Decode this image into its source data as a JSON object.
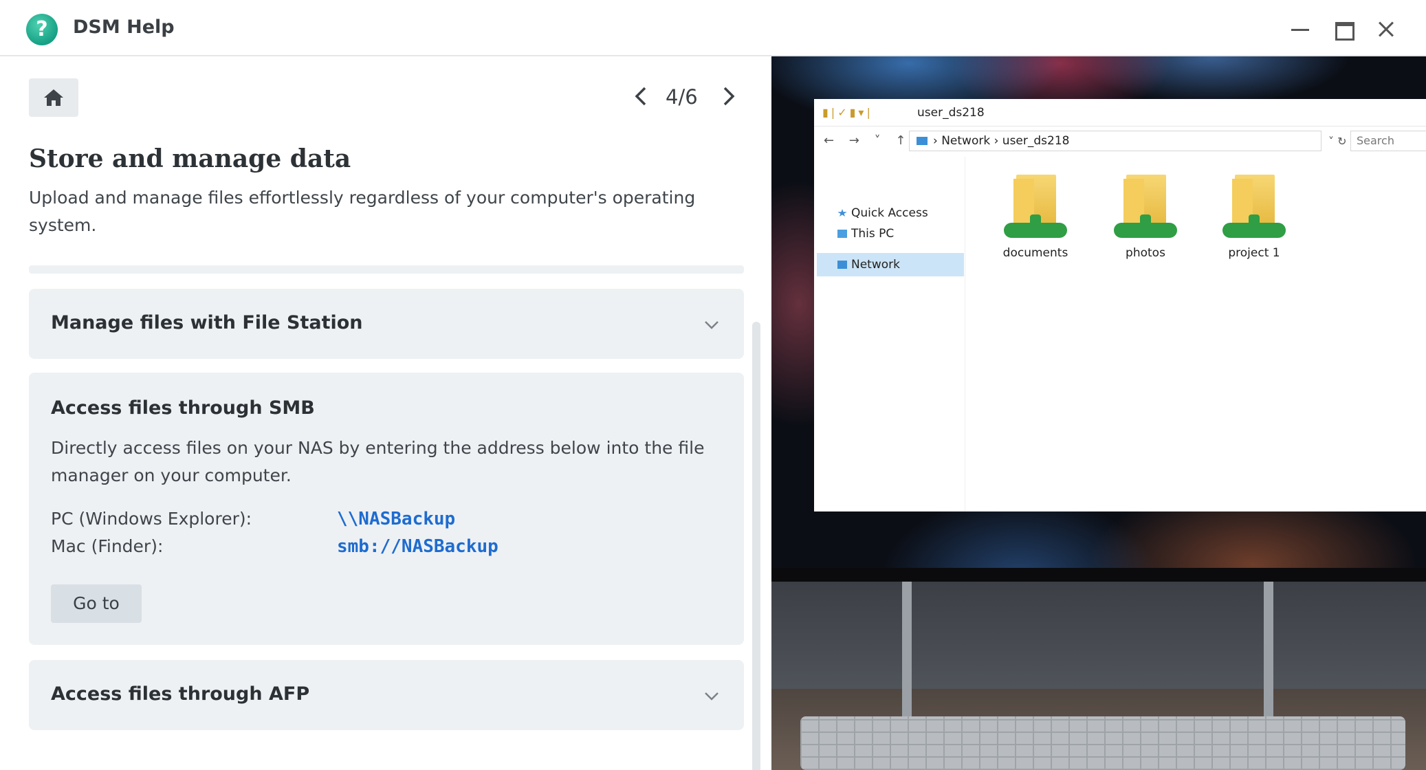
{
  "window": {
    "title": "DSM Help",
    "logo_glyph": "?",
    "controls": [
      "minimize-icon",
      "maximize-icon",
      "close-icon"
    ]
  },
  "nav": {
    "home_icon": "home-icon",
    "prev_icon": "chevron-left-icon",
    "next_icon": "chevron-right-icon",
    "page_indicator": "4/6"
  },
  "content": {
    "title": "Store and manage data",
    "description": "Upload and manage files effortlessly regardless of your computer's operating system.",
    "sections": [
      {
        "title": "Manage files with File Station",
        "expanded": false
      },
      {
        "title": "Access files through SMB",
        "expanded": true,
        "description": "Directly access files on your NAS by entering the address below into the file manager on your computer.",
        "rows": [
          {
            "label": "PC (Windows Explorer):",
            "value": "\\\\NASBackup"
          },
          {
            "label": "Mac (Finder):",
            "value": "smb://NASBackup"
          }
        ],
        "button_label": "Go to"
      },
      {
        "title": "Access files through AFP",
        "expanded": false
      }
    ]
  },
  "explorer": {
    "title": "user_ds218",
    "address_path": "› Network › user_ds218",
    "search_placeholder": "Search",
    "sidebar": [
      "Quick Access",
      "This PC",
      "Network"
    ],
    "selected_sidebar": "Network",
    "folders": [
      "documents",
      "photos",
      "project 1"
    ]
  },
  "colors": {
    "link": "#1e6ccf",
    "card_bg": "#eef1f4",
    "logo": "#16a085"
  }
}
